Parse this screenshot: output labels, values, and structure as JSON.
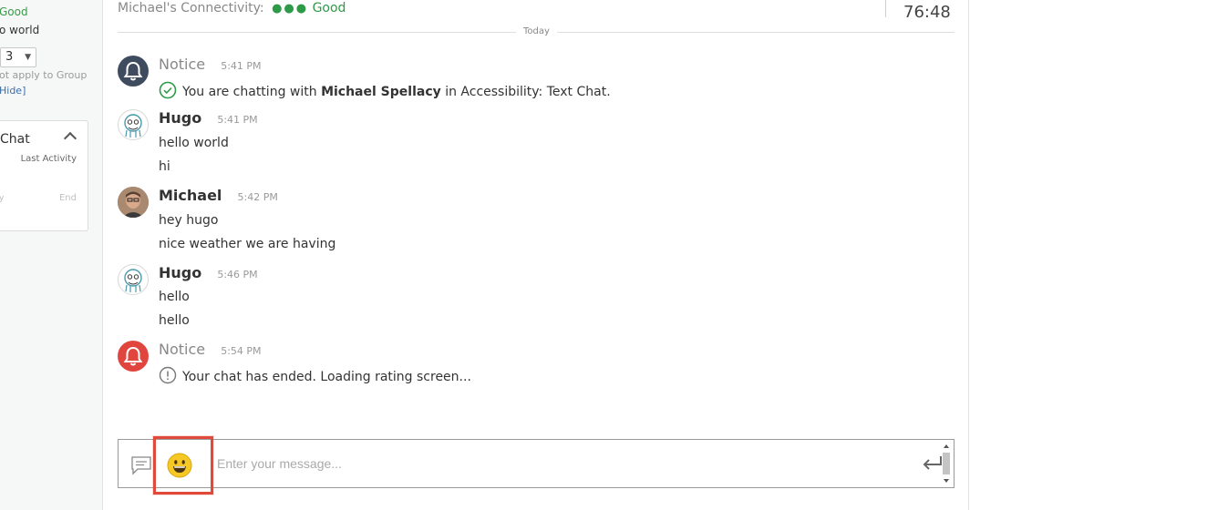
{
  "sidebar": {
    "status_text": "Good",
    "world_text": "o world",
    "select_value": "3",
    "note_text": "ot apply to Group",
    "hide_link": "Hide]",
    "card": {
      "title": "Chat",
      "last_activity_label": "Last Activity",
      "row_mark": "y",
      "row_end": "End"
    }
  },
  "header": {
    "connectivity_label": "Michael's Connectivity:",
    "connectivity_dots": "●●●",
    "connectivity_status": "Good",
    "timer": "76:48"
  },
  "day_separator": "Today",
  "messages": [
    {
      "sender": "Notice",
      "time": "5:41 PM",
      "avatar": "bell-icon",
      "lines": [
        {
          "pre": "You are chatting with ",
          "bold": "Michael Spellacy",
          "post": " in Accessibility: Text Chat."
        }
      ]
    },
    {
      "sender": "Hugo",
      "time": "5:41 PM",
      "avatar": "hugo-avatar",
      "lines": [
        "hello world",
        "hi"
      ]
    },
    {
      "sender": "Michael",
      "time": "5:42 PM",
      "avatar": "michael-avatar",
      "lines": [
        "hey hugo",
        "nice weather we are having"
      ]
    },
    {
      "sender": "Hugo",
      "time": "5:46 PM",
      "avatar": "hugo-avatar",
      "lines": [
        "hello",
        "hello"
      ]
    },
    {
      "sender": "Notice",
      "time": "5:54 PM",
      "avatar": "bell-icon",
      "lines": [
        "Your chat has ended. Loading rating screen..."
      ]
    }
  ],
  "composer": {
    "placeholder": "Enter your message...",
    "value": ""
  },
  "colors": {
    "connectivity_good": "#2e9a47",
    "notice_avatar_dark": "#3f4b5e",
    "notice_avatar_red": "#e0463e",
    "emoji_highlight": "#e04a3a",
    "success_check": "#2e9a47"
  },
  "icons": [
    "bell-icon",
    "check-circle-icon",
    "alert-circle-icon",
    "chat-bubble-icon",
    "emoji-icon",
    "send-enter-icon"
  ]
}
